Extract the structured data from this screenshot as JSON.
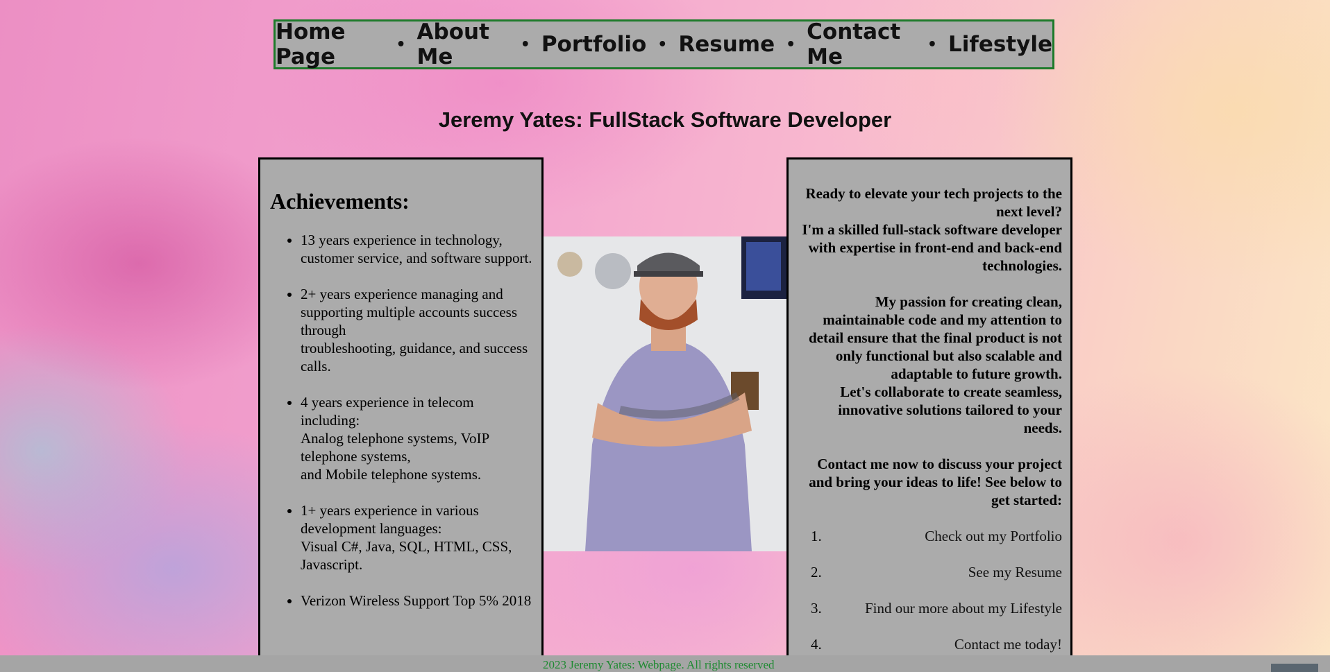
{
  "nav": {
    "items": [
      "Home Page",
      "About Me",
      "Portfolio",
      "Resume",
      "Contact Me",
      "Lifestyle"
    ],
    "separator": "•"
  },
  "headline": "Jeremy Yates: FullStack Software Developer",
  "achievements": {
    "title": "Achievements:",
    "items": [
      "13 years experience in technology, customer service, and software support.",
      "2+ years experience managing and supporting multiple accounts success through\ntroubleshooting, guidance, and success calls.",
      "4 years experience in telecom including:\nAnalog telephone systems, VoIP telephone systems,\nand Mobile telephone systems.",
      "1+ years experience in various development languages:\nVisual C#, Java, SQL, HTML, CSS, Javascript.",
      "Verizon Wireless Support Top 5% 2018"
    ]
  },
  "intro": {
    "p1": "Ready to elevate your tech projects to the next level?\nI'm a skilled full-stack software developer with expertise in front-end and back-end technologies.",
    "p2": "My passion for creating clean, maintainable code and my attention to detail ensure that the final product is not only functional but also scalable and adaptable to future growth.\nLet's collaborate to create seamless, innovative solutions tailored to your needs.",
    "p3": "Contact me now to discuss your project and bring your ideas to life! See below to get started:",
    "steps": [
      {
        "num": "1.",
        "label": "Check out my Portfolio"
      },
      {
        "num": "2.",
        "label": "See my Resume"
      },
      {
        "num": "3.",
        "label": "Find our more about my Lifestyle"
      },
      {
        "num": "4.",
        "label": "Contact me today!"
      }
    ]
  },
  "footer": {
    "text": "2023 Jeremy Yates: Webpage. All rights reserved"
  },
  "colors": {
    "panel": "#ababab",
    "nav_border": "#1d7a2a",
    "footer_text": "#1f8a32"
  }
}
